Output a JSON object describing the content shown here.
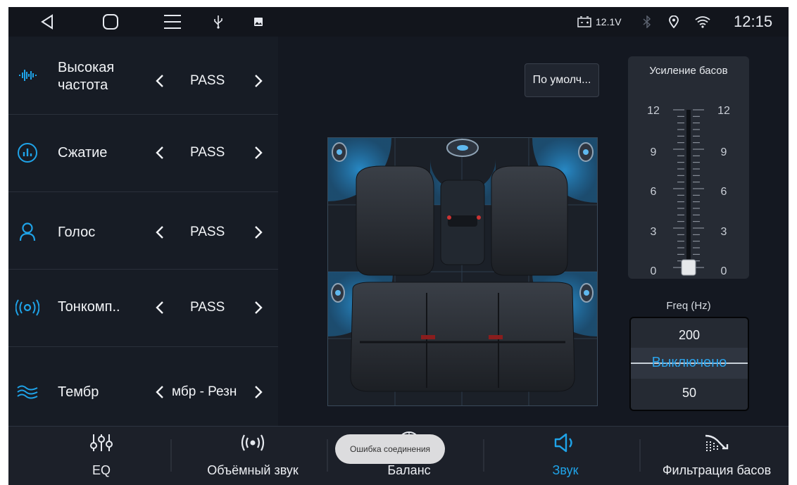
{
  "statusbar": {
    "battery_voltage": "12.1V",
    "time": "12:15",
    "icons": [
      "back-icon",
      "home-icon",
      "menu-icon",
      "usb-icon",
      "image-icon",
      "battery-icon",
      "bluetooth-icon",
      "location-icon",
      "wifi-icon"
    ]
  },
  "left_panel": {
    "rows": [
      {
        "icon": "equalizer-wave-icon",
        "label_line1": "Высокая",
        "label_line2": "частота",
        "value": "PASS"
      },
      {
        "icon": "bars-circle-icon",
        "label": "Сжатие",
        "value": "PASS"
      },
      {
        "icon": "person-icon",
        "label": "Голос",
        "value": "PASS"
      },
      {
        "icon": "radio-waves-icon",
        "label": "Тонкомп..",
        "value": "PASS"
      },
      {
        "icon": "waves-icon",
        "label": "Тембр",
        "value": "мбр - Резн"
      }
    ]
  },
  "main": {
    "default_button": "По умолч...",
    "bass_boost": {
      "title": "Усиление басов",
      "scale": [
        "12",
        "9",
        "6",
        "3",
        "0"
      ],
      "value": 0
    },
    "freq": {
      "title": "Freq (Hz)",
      "options": [
        "200",
        "Выключено",
        "50"
      ],
      "selected": "Выключено"
    }
  },
  "bottom_nav": {
    "tabs": [
      {
        "icon": "sliders-icon",
        "label": "EQ"
      },
      {
        "icon": "surround-icon",
        "label": "Объёмный звук"
      },
      {
        "icon": "balance-icon",
        "label": "Баланс"
      },
      {
        "icon": "speaker-icon",
        "label": "Звук",
        "active": true
      },
      {
        "icon": "bass-filter-icon",
        "label": "Фильтрация басов"
      }
    ]
  },
  "toast": "Ошибка соединения",
  "colors": {
    "accent": "#1fa3e8",
    "background": "#141821"
  }
}
